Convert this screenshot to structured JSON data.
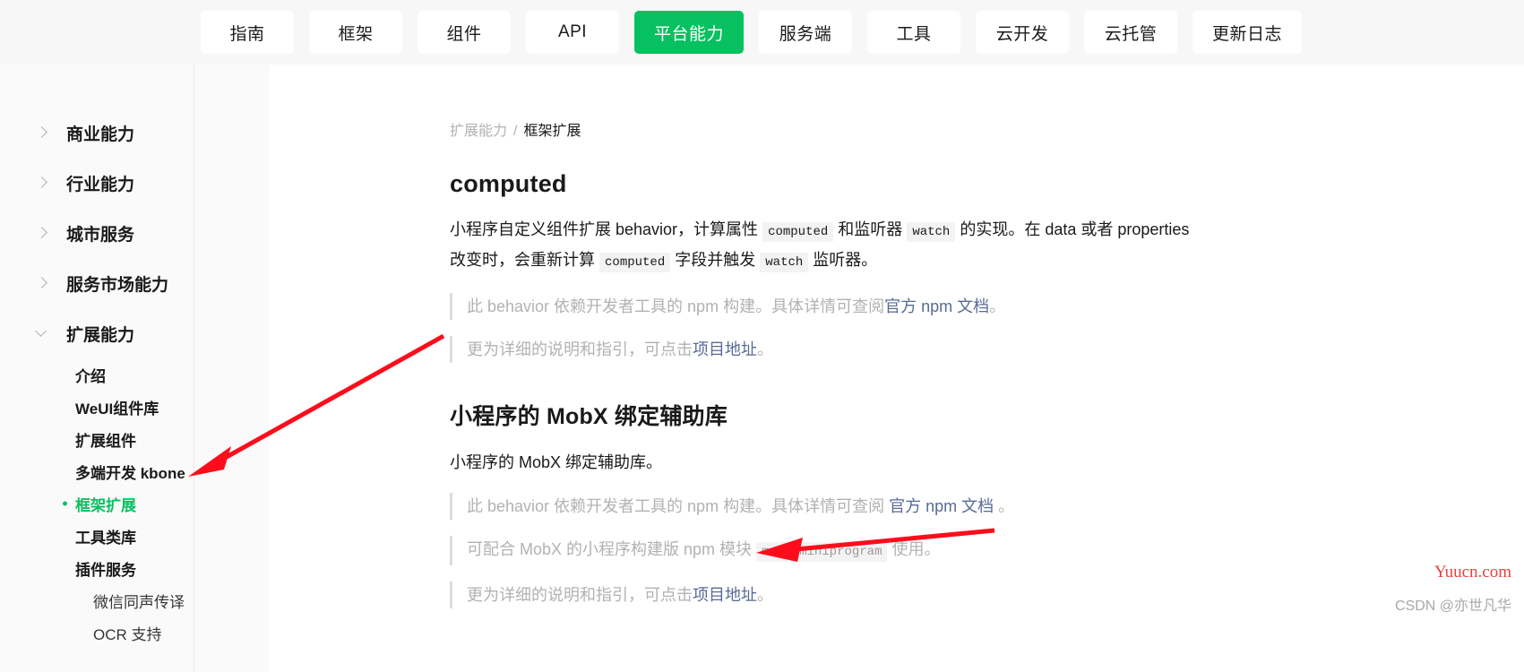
{
  "topnav": {
    "items": [
      {
        "label": "指南",
        "active": false
      },
      {
        "label": "框架",
        "active": false
      },
      {
        "label": "组件",
        "active": false
      },
      {
        "label": "API",
        "active": false
      },
      {
        "label": "平台能力",
        "active": true
      },
      {
        "label": "服务端",
        "active": false
      },
      {
        "label": "工具",
        "active": false
      },
      {
        "label": "云开发",
        "active": false
      },
      {
        "label": "云托管",
        "active": false
      },
      {
        "label": "更新日志",
        "active": false
      }
    ],
    "active_color": "#07c160"
  },
  "sidebar": {
    "groups": [
      {
        "label": "商业能力",
        "expanded": false
      },
      {
        "label": "行业能力",
        "expanded": false
      },
      {
        "label": "城市服务",
        "expanded": false
      },
      {
        "label": "服务市场能力",
        "expanded": false
      },
      {
        "label": "扩展能力",
        "expanded": true
      }
    ],
    "sub_items": [
      {
        "label": "介绍",
        "active": false
      },
      {
        "label": "WeUI组件库",
        "active": false
      },
      {
        "label": "扩展组件",
        "active": false
      },
      {
        "label": "多端开发 kbone",
        "active": false
      },
      {
        "label": "框架扩展",
        "active": true
      },
      {
        "label": "工具类库",
        "active": false
      },
      {
        "label": "插件服务",
        "active": false
      }
    ],
    "sub_sub_items": [
      {
        "label": "微信同声传译"
      },
      {
        "label": "OCR 支持"
      }
    ],
    "active_color": "#07c160"
  },
  "breadcrumb": {
    "parent": "扩展能力",
    "separator": "/",
    "current": "框架扩展"
  },
  "sections": [
    {
      "title": "computed",
      "paragraph": {
        "p1": "小程序自定义组件扩展 behavior，计算属性",
        "c1": "computed",
        "p2": "和监听器",
        "c2": "watch",
        "p3": "的实现。在 data 或者 properties 改变时，会重新计算",
        "c3": "computed",
        "p4": "字段并触发",
        "c4": "watch",
        "p5": "监听器。"
      },
      "quotes": [
        {
          "pre": "此 behavior 依赖开发者工具的 npm 构建。具体详情可查阅",
          "link": "官方 npm 文档",
          "post": "。"
        },
        {
          "pre": "更为详细的说明和指引，可点击",
          "link": "项目地址",
          "post": "。"
        }
      ]
    },
    {
      "title": "小程序的 MobX 绑定辅助库",
      "paragraph_plain": "小程序的 MobX 绑定辅助库。",
      "quotes": [
        {
          "pre": "此 behavior 依赖开发者工具的 npm 构建。具体详情可查阅 ",
          "link": "官方 npm 文档",
          "post": " 。"
        },
        {
          "pre": "可配合 MobX 的小程序构建版 npm 模块",
          "code": "mobx-miniprogram",
          "post": "使用。"
        },
        {
          "pre": "更为详细的说明和指引，可点击",
          "link": "项目地址",
          "post": "。"
        }
      ]
    }
  ],
  "annotations": {
    "arrow_color": "#fc0d1c",
    "arrow1_target": "框架扩展",
    "arrow2_target": "项目地址"
  },
  "watermarks": {
    "red": "Yuucn.com",
    "gray": "CSDN @亦世凡华"
  }
}
